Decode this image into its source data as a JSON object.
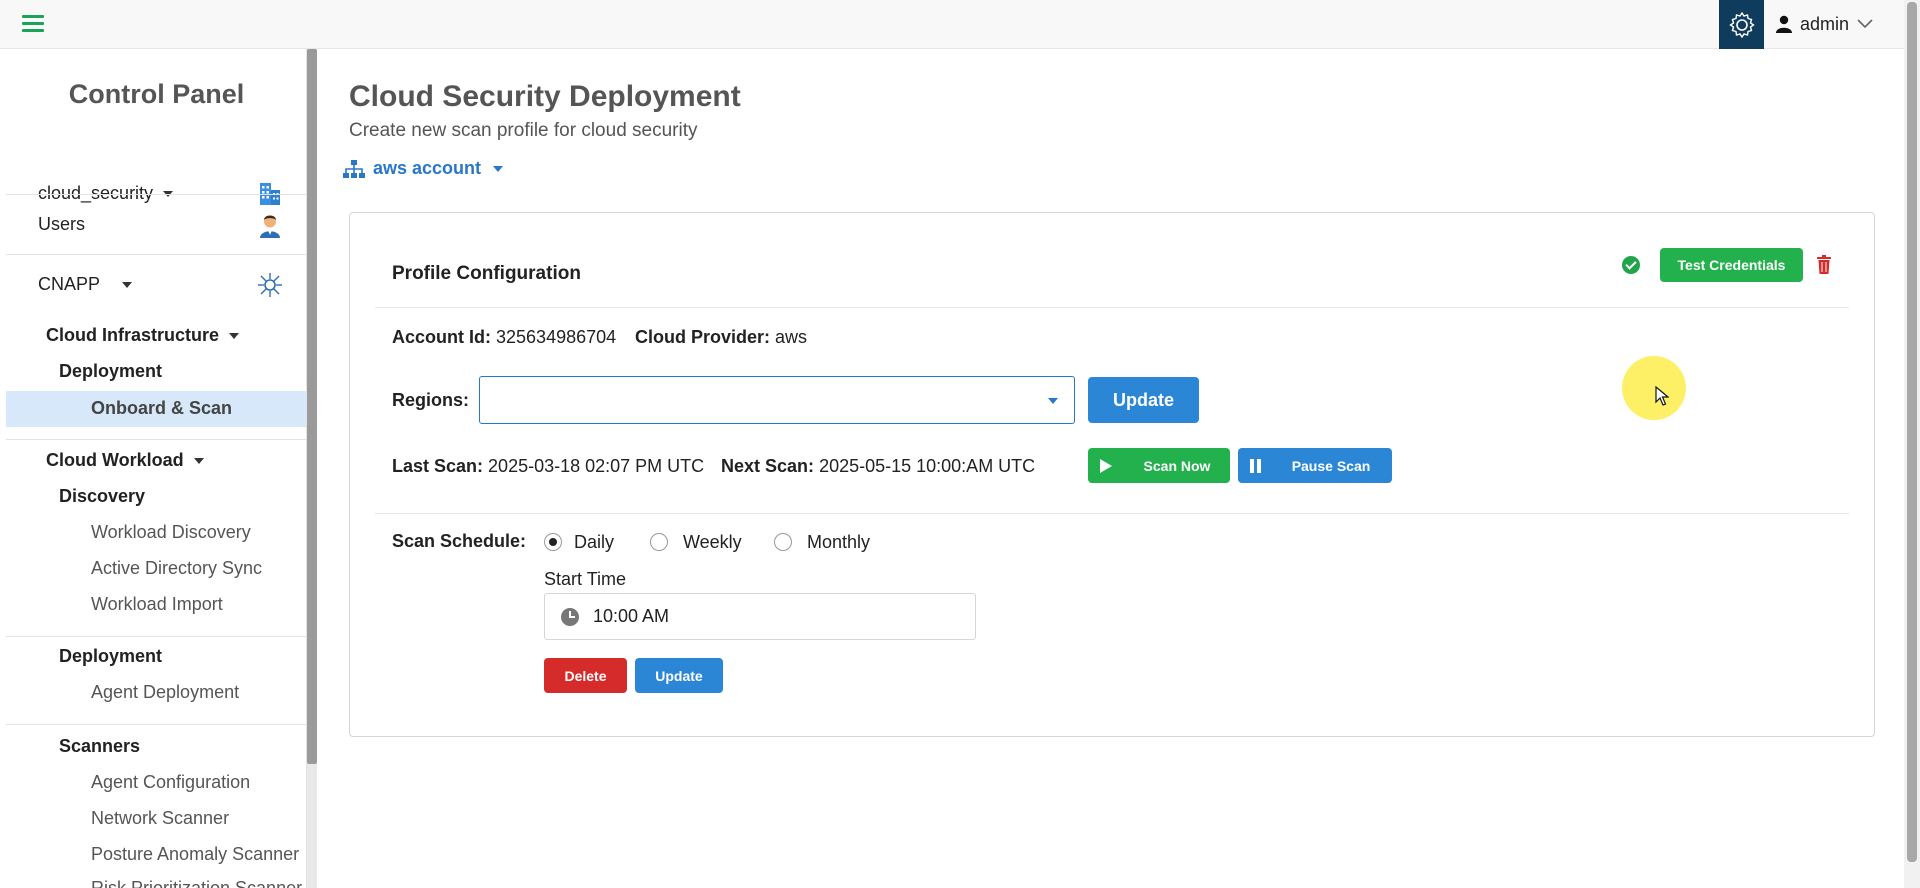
{
  "topbar": {
    "user_label": "admin"
  },
  "sidebar": {
    "title": "Control Panel",
    "tenant": "cloud_security",
    "users": "Users",
    "cnapp": "CNAPP",
    "cloud_infrastructure": "Cloud Infrastructure",
    "deployment_1": "Deployment",
    "onboard_scan": "Onboard & Scan",
    "cloud_workload": "Cloud Workload",
    "discovery": "Discovery",
    "workload_discovery": "Workload Discovery",
    "ad_sync": "Active Directory Sync",
    "workload_import": "Workload Import",
    "deployment_2": "Deployment",
    "agent_deployment": "Agent Deployment",
    "scanners": "Scanners",
    "agent_configuration": "Agent Configuration",
    "network_scanner": "Network Scanner",
    "posture_anomaly_scanner": "Posture Anomaly Scanner",
    "risk_prioritization_scanner": "Risk Prioritization Scanner"
  },
  "main": {
    "title": "Cloud Security Deployment",
    "subtitle": "Create new scan profile for cloud security",
    "account_selector": "aws account"
  },
  "profile": {
    "title": "Profile Configuration",
    "test_credentials_label": "Test Credentials",
    "account_id_label": "Account Id:",
    "account_id": "325634986704",
    "cloud_provider_label": "Cloud Provider:",
    "cloud_provider": "aws",
    "regions_label": "Regions:",
    "regions_value": "",
    "update_label": "Update",
    "last_scan_label": "Last Scan:",
    "last_scan": "2025-03-18 02:07 PM UTC",
    "next_scan_label": "Next Scan:",
    "next_scan": "2025-05-15 10:00:AM UTC",
    "scan_now_label": "Scan Now",
    "pause_scan_label": "Pause Scan"
  },
  "schedule": {
    "label": "Scan Schedule:",
    "options": [
      "Daily",
      "Weekly",
      "Monthly"
    ],
    "selected": "Daily",
    "start_time_label": "Start Time",
    "start_time": "10:00 AM",
    "delete_label": "Delete",
    "update_label": "Update"
  },
  "colors": {
    "accent_blue": "#2b86d6",
    "success_green": "#22b14c",
    "danger_red": "#d62b2b",
    "header_dark": "#0f3b5c",
    "active_nav_bg": "#d6e8f9"
  },
  "icons": [
    "hamburger-icon",
    "gear-icon",
    "user-icon",
    "chevron-down-icon",
    "building-icon",
    "user-avatar-icon",
    "cnapp-hub-icon",
    "sitemap-icon",
    "check-circle-icon",
    "trash-icon",
    "play-icon",
    "pause-icon",
    "clock-icon"
  ]
}
